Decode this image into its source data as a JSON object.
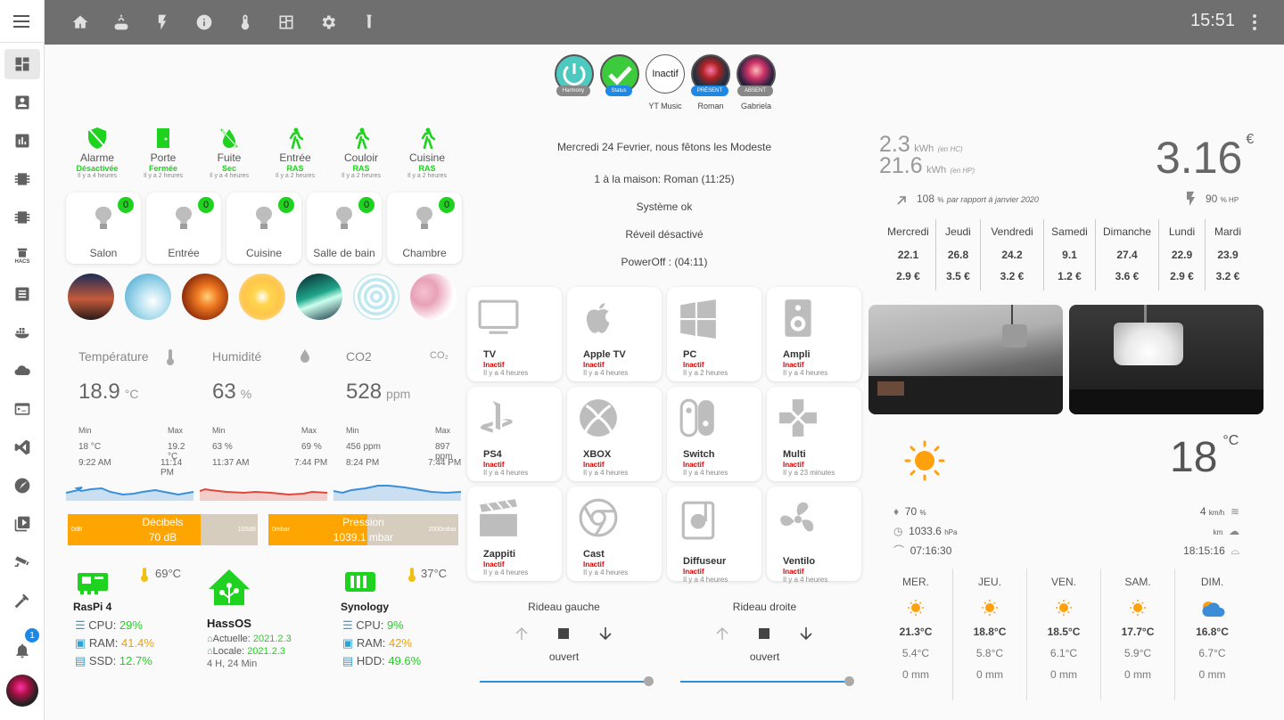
{
  "sidebar": {
    "hacs": "HACS",
    "badge": "1",
    "items": [
      "dashboard",
      "person",
      "chart",
      "chip",
      "chip2",
      "hacs",
      "notes",
      "docker",
      "cloud",
      "terminal",
      "vscode",
      "compass",
      "media",
      "cctv",
      "hammer"
    ]
  },
  "topbar": {
    "time": "15:51",
    "tabs": [
      "home",
      "weather",
      "power",
      "info",
      "thermometer",
      "floorplan",
      "settings",
      "lab"
    ]
  },
  "persons": [
    {
      "badge": "Harmony",
      "bg": "#4ec9c0"
    },
    {
      "badge": "Status",
      "bg": "#3ccb3c"
    },
    {
      "label": "Inactif",
      "caption": "YT Music"
    },
    {
      "badge": "PRÉSENT",
      "caption": "Roman"
    },
    {
      "badge": "ABSENT",
      "caption": "Gabriela"
    }
  ],
  "sensors": [
    {
      "name": "Alarme",
      "state": "Désactivée",
      "time": "Il y a 4 heures"
    },
    {
      "name": "Porte",
      "state": "Fermée",
      "time": "Il y a 2 heures"
    },
    {
      "name": "Fuite",
      "state": "Sec",
      "time": "Il y a 4 heures"
    },
    {
      "name": "Entrée",
      "state": "RAS",
      "time": "Il y a 2 heures"
    },
    {
      "name": "Couloir",
      "state": "RAS",
      "time": "Il y a 2 heures"
    },
    {
      "name": "Cuisine",
      "state": "RAS",
      "time": "Il y a 2 heures"
    }
  ],
  "lights": [
    {
      "name": "Salon",
      "count": "0"
    },
    {
      "name": "Entrée",
      "count": "0"
    },
    {
      "name": "Cuisine",
      "count": "0"
    },
    {
      "name": "Salle de bain",
      "count": "0"
    },
    {
      "name": "Chambre",
      "count": "0"
    }
  ],
  "climate": [
    {
      "title": "Température",
      "value": "18.9",
      "unit": "°C",
      "min": "Min",
      "max": "Max",
      "minv": "18 °C",
      "maxv": "19.2 °C",
      "mint": "9:22 AM",
      "maxt": "11:14 PM",
      "color": "#3a8fd9"
    },
    {
      "title": "Humidité",
      "value": "63",
      "unit": "%",
      "min": "Min",
      "max": "Max",
      "minv": "63 %",
      "maxv": "69 %",
      "mint": "11:37 AM",
      "maxt": "7:44 PM",
      "color": "#e0483d"
    },
    {
      "title": "CO2",
      "value": "528",
      "unit": "ppm",
      "min": "Min",
      "max": "Max",
      "minv": "456 ppm",
      "maxv": "897 ppm",
      "mint": "8:24 PM",
      "maxt": "7:44 PM",
      "color": "#3a8fd9",
      "icon": "CO₂"
    }
  ],
  "bars": [
    {
      "title": "Décibels",
      "value": "70 dB",
      "min": "0dB",
      "max": "100dB",
      "fill": 0.7
    },
    {
      "title": "Pression",
      "value": "1039.1 mbar",
      "min": "0mbar",
      "max": "2000mbar",
      "fill": 0.52
    }
  ],
  "systems": [
    {
      "name": "RasPi 4",
      "temp": "69°C",
      "l1": "CPU: ",
      "v1": "29%",
      "l2": "RAM: ",
      "v2": "41.4%",
      "l3": "SSD: ",
      "v3": "12.7%"
    },
    {
      "name": "HassOS",
      "l1": "Actuelle: ",
      "v1": "2021.2.3",
      "l2": "Locale: ",
      "v2": "2021.2.3",
      "uptime": "4 H, 24 Min"
    },
    {
      "name": "Synology",
      "temp": "37°C",
      "l1": "CPU: ",
      "v1": "9%",
      "l2": "RAM: ",
      "v2": "42%",
      "l3": "HDD: ",
      "v3": "49.6%"
    }
  ],
  "info": {
    "date": "Mercredi 24 Fevrier, nous fêtons les Modeste",
    "home": "1 à la maison: Roman (11:25)",
    "system": "Système ok",
    "alarm": "Réveil désactivé",
    "power": "PowerOff : (04:11)"
  },
  "media": [
    {
      "name": "TV",
      "state": "Inactif",
      "time": "Il y a 4 heures"
    },
    {
      "name": "Apple TV",
      "state": "Inactif",
      "time": "Il y a 4 heures"
    },
    {
      "name": "PC",
      "state": "Inactif",
      "time": "Il y a 2 heures"
    },
    {
      "name": "Ampli",
      "state": "Inactif",
      "time": "Il y a 4 heures"
    },
    {
      "name": "PS4",
      "state": "Inactif",
      "time": "Il y a 4 heures"
    },
    {
      "name": "XBOX",
      "state": "Inactif",
      "time": "Il y a 4 heures"
    },
    {
      "name": "Switch",
      "state": "Inactif",
      "time": "Il y a 4 heures"
    },
    {
      "name": "Multi",
      "state": "Inactif",
      "time": "Il y a 23 minutes"
    },
    {
      "name": "Zappiti",
      "state": "Inactif",
      "time": "Il y a 4 heures"
    },
    {
      "name": "Cast",
      "state": "Inactif",
      "time": "Il y a 4 heures"
    },
    {
      "name": "Diffuseur",
      "state": "Inactif",
      "time": "Il y a 4 heures"
    },
    {
      "name": "Ventilo",
      "state": "Inactif",
      "time": "Il y a 4 heures"
    }
  ],
  "covers": [
    {
      "name": "Rideau gauche",
      "state": "ouvert"
    },
    {
      "name": "Rideau droite",
      "state": "ouvert"
    }
  ],
  "energy": {
    "hc": "2.3",
    "hc_unit": "kWh",
    "hc_label": "(en HC)",
    "hp": "21.6",
    "hp_unit": "kWh",
    "hp_label": "(en HP)",
    "cost": "3.16",
    "cur": "€",
    "pct": "108",
    "pct_unit": "%",
    "pct_label": "par rapport à janvier 2020",
    "hpPct": "90",
    "hpPct_unit": "% HP",
    "days": [
      {
        "d": "Mercredi",
        "k": "22.1",
        "e": "2.9 €"
      },
      {
        "d": "Jeudi",
        "k": "26.8",
        "e": "3.5 €"
      },
      {
        "d": "Vendredi",
        "k": "24.2",
        "e": "3.2 €"
      },
      {
        "d": "Samedi",
        "k": "9.1",
        "e": "1.2 €"
      },
      {
        "d": "Dimanche",
        "k": "27.4",
        "e": "3.6 €"
      },
      {
        "d": "Lundi",
        "k": "22.9",
        "e": "2.9 €"
      },
      {
        "d": "Mardi",
        "k": "23.9",
        "e": "3.2 €"
      }
    ]
  },
  "weather": {
    "temp": "18",
    "unit": "°C",
    "hum": "70",
    "hum_u": "%",
    "press": "1033.6",
    "press_u": "hPa",
    "rise": "07:16:30",
    "wind": "4",
    "wind_u": "km/h",
    "vis_u": "km",
    "set": "18:15:16",
    "days": [
      {
        "d": "MER.",
        "hi": "21.3°C",
        "lo": "5.4°C",
        "r": "0 mm",
        "icon": "sun"
      },
      {
        "d": "JEU.",
        "hi": "18.8°C",
        "lo": "5.8°C",
        "r": "0 mm",
        "icon": "sun"
      },
      {
        "d": "VEN.",
        "hi": "18.5°C",
        "lo": "6.1°C",
        "r": "0 mm",
        "icon": "sun"
      },
      {
        "d": "SAM.",
        "hi": "17.7°C",
        "lo": "5.9°C",
        "r": "0 mm",
        "icon": "sun"
      },
      {
        "d": "DIM.",
        "hi": "16.8°C",
        "lo": "6.7°C",
        "r": "0 mm",
        "icon": "partly-cloudy"
      }
    ]
  }
}
